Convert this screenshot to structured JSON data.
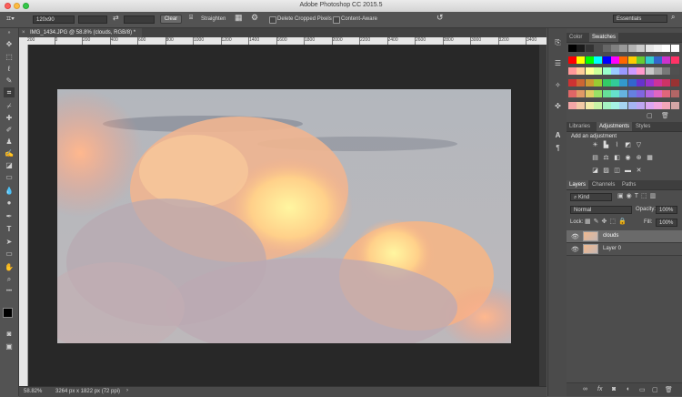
{
  "app": {
    "title": "Adobe Photoshop CC 2015.5"
  },
  "options_bar": {
    "ratio_value": "120x90",
    "clear_label": "Clear",
    "straighten_label": "Straighten",
    "delete_cropped_label": "Delete Cropped Pixels",
    "content_aware_label": "Content-Aware",
    "workspace_label": "Essentials"
  },
  "document": {
    "tab_label": "IMG_1434.JPG @ 58.8% (clouds, RGB/8) *",
    "zoom": "58.82%",
    "doc_info": "3264 px x 1822 px (72 ppi)",
    "ruler_ticks": [
      "200",
      "0",
      "200",
      "400",
      "600",
      "800",
      "1000",
      "1200",
      "1400",
      "1600",
      "1800",
      "2000",
      "2200",
      "2400",
      "2600",
      "2800",
      "3000",
      "3200",
      "3400"
    ]
  },
  "colors": {
    "foreground": "#000000",
    "background": "#ffffff",
    "accent": "#4a7bc4"
  },
  "panels": {
    "top_tabs": [
      "Color",
      "Swatches"
    ],
    "mid_tabs": [
      "Libraries",
      "Adjustments",
      "Styles"
    ],
    "add_adjustment": "Add an adjustment",
    "layer_tabs": [
      "Layers",
      "Channels",
      "Paths"
    ],
    "kind_label": "Kind",
    "blend_mode": "Normal",
    "opacity_label": "Opacity:",
    "opacity_value": "100%",
    "lock_label": "Lock:",
    "fill_label": "Fill:",
    "fill_value": "100%",
    "layers": [
      {
        "name": "clouds"
      },
      {
        "name": "Layer 0"
      }
    ]
  },
  "swatches": {
    "rows": [
      [
        "#000000",
        "#1a1a1a",
        "#333333",
        "#4d4d4d",
        "#666666",
        "#808080",
        "#999999",
        "#b3b3b3",
        "#cccccc",
        "#e6e6e6",
        "#f2f2f2",
        "#ffffff",
        "#ffffff"
      ],
      [
        "#ff0000",
        "#ffff00",
        "#00ff00",
        "#00ffff",
        "#0000ff",
        "#ff00ff",
        "#ff6600",
        "#ffcc00",
        "#66cc33",
        "#33cccc",
        "#3366cc",
        "#cc33cc",
        "#ff3366"
      ],
      [
        "#ff9999",
        "#ffcc99",
        "#ffff99",
        "#ccff99",
        "#99ffcc",
        "#99ccff",
        "#9999ff",
        "#cc99ff",
        "#ff99cc",
        "#c8c8c8",
        "#a0a0a0",
        "#787878",
        "#505050"
      ],
      [
        "#cc3333",
        "#cc6633",
        "#cc9933",
        "#99cc33",
        "#33cc66",
        "#33cc99",
        "#3399cc",
        "#3366cc",
        "#6633cc",
        "#9933cc",
        "#cc3399",
        "#cc3366",
        "#993333"
      ],
      [
        "#e06666",
        "#e09966",
        "#e0cc66",
        "#99e066",
        "#66e099",
        "#66e0cc",
        "#66b3e0",
        "#6680e0",
        "#8066e0",
        "#b366e0",
        "#e066c2",
        "#e0667a",
        "#b36666"
      ],
      [
        "#f2a6a6",
        "#f2c9a6",
        "#f2ebaa",
        "#c9f2a6",
        "#a6f2c2",
        "#a6f2e6",
        "#a6d4f2",
        "#a6b4f2",
        "#bea6f2",
        "#dba6f2",
        "#f2a6df",
        "#f2a6b8",
        "#d4a6a6"
      ]
    ]
  }
}
